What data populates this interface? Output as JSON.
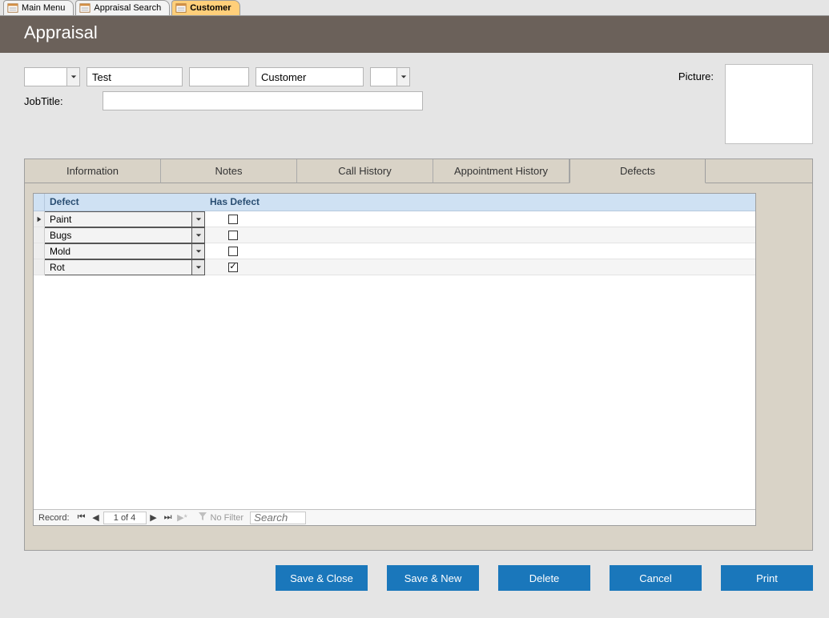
{
  "doc_tabs": {
    "main_menu": "Main Menu",
    "appraisal_search": "Appraisal Search",
    "customer": "Customer"
  },
  "header": {
    "title": "Appraisal"
  },
  "fields": {
    "first_name": "Test",
    "middle": "",
    "last_name": "Customer",
    "suffix": "",
    "jobtitle_label": "JobTitle:",
    "jobtitle_value": "",
    "picture_label": "Picture:"
  },
  "tabs": {
    "information": "Information",
    "notes": "Notes",
    "call_history": "Call History",
    "appointment_history": "Appointment History",
    "defects": "Defects"
  },
  "defects_grid": {
    "col_defect": "Defect",
    "col_hasdefect": "Has Defect",
    "rows": [
      {
        "name": "Paint",
        "has": false,
        "current": true
      },
      {
        "name": "Bugs",
        "has": false,
        "current": false
      },
      {
        "name": "Mold",
        "has": false,
        "current": false
      },
      {
        "name": "Rot",
        "has": true,
        "current": false
      }
    ]
  },
  "record_nav": {
    "label": "Record:",
    "position": "1 of 4",
    "filter": "No Filter",
    "search_placeholder": "Search"
  },
  "buttons": {
    "save_close": "Save & Close",
    "save_new": "Save & New",
    "delete": "Delete",
    "cancel": "Cancel",
    "print": "Print"
  }
}
